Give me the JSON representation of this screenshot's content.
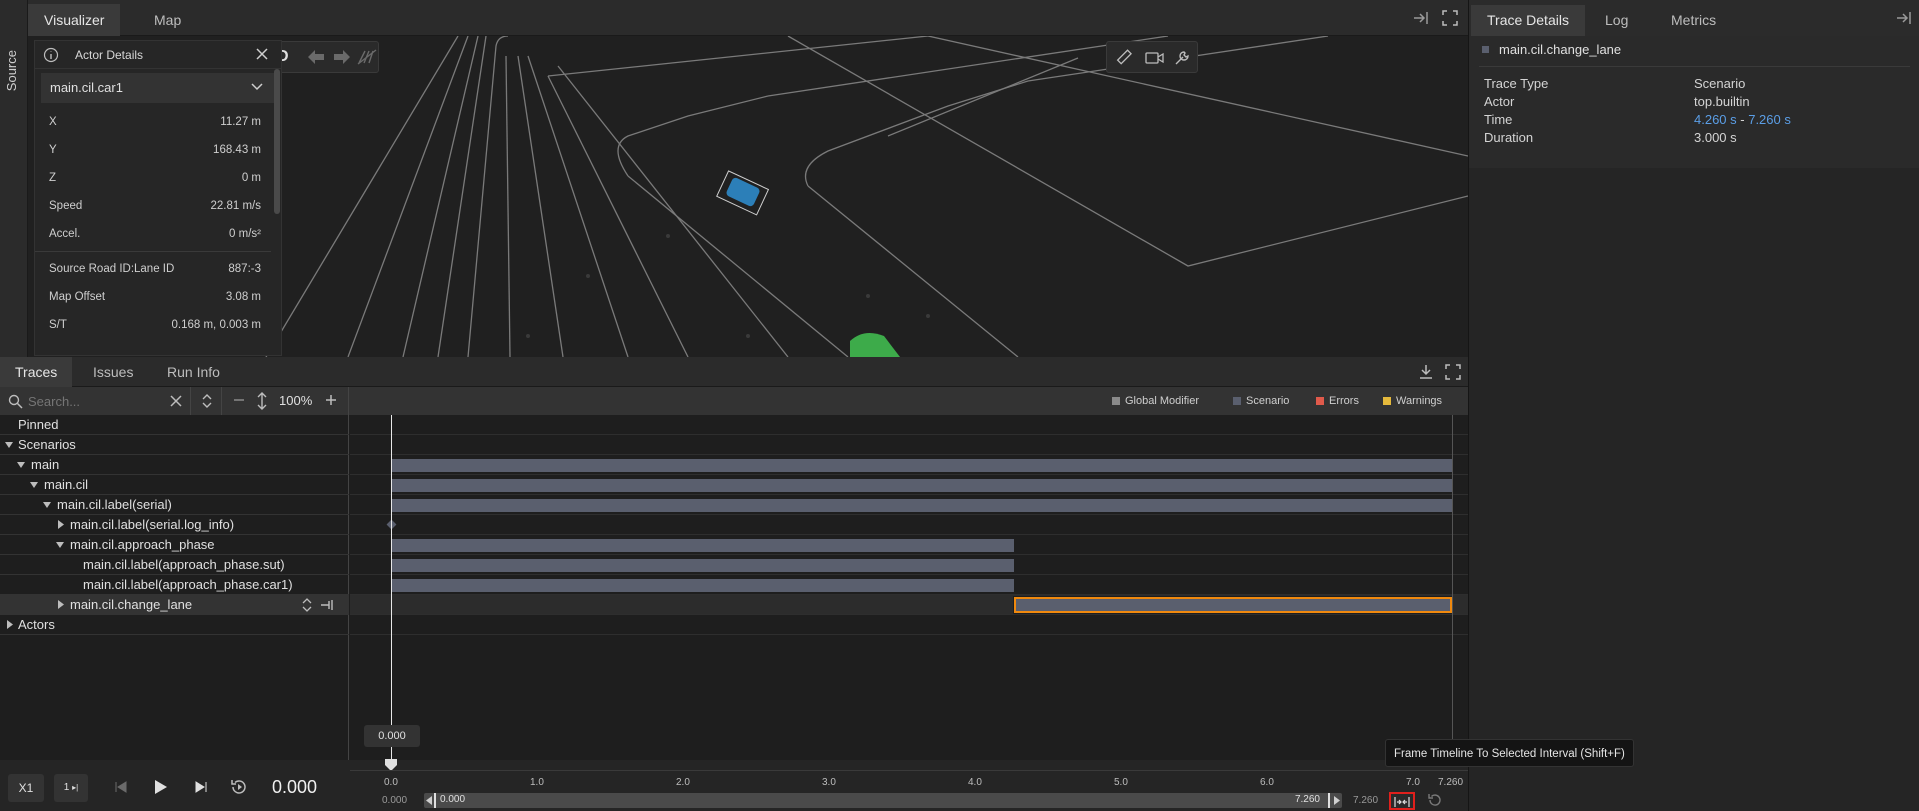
{
  "source_strip": {
    "label": "Source"
  },
  "top_tabs": [
    {
      "label": "Visualizer"
    },
    {
      "label": "Map"
    }
  ],
  "viewport_toolbar": {
    "drive_mode": "D"
  },
  "actor_details": {
    "title": "Actor Details",
    "selected_actor": "main.cil.car1",
    "rows": [
      {
        "label": "X",
        "value": "11.27 m"
      },
      {
        "label": "Y",
        "value": "168.43 m"
      },
      {
        "label": "Z",
        "value": "0 m"
      },
      {
        "label": "Speed",
        "value": "22.81 m/s"
      },
      {
        "label": "Accel.",
        "value": "0 m/s²"
      },
      {
        "label": "Source Road ID:Lane ID",
        "value": "887:-3"
      },
      {
        "label": "Map Offset",
        "value": "3.08 m"
      },
      {
        "label": "S/T",
        "value": "0.168 m, 0.003 m"
      }
    ]
  },
  "right_panel": {
    "tabs": [
      {
        "label": "Trace Details"
      },
      {
        "label": "Log"
      },
      {
        "label": "Metrics"
      }
    ],
    "trace_name": "main.cil.change_lane",
    "details": {
      "trace_type_label": "Trace Type",
      "trace_type": "Scenario",
      "actor_label": "Actor",
      "actor": "top.builtin",
      "time_label": "Time",
      "time_start": "4.260 s",
      "time_sep": " - ",
      "time_end": "7.260 s",
      "duration_label": "Duration",
      "duration": "3.000 s"
    }
  },
  "bottom_tabs": [
    {
      "label": "Traces"
    },
    {
      "label": "Issues"
    },
    {
      "label": "Run Info"
    }
  ],
  "search": {
    "placeholder": "Search...",
    "zoom": "100%"
  },
  "legend": [
    {
      "label": "Global Modifier",
      "color": "#8a8a8a"
    },
    {
      "label": "Scenario",
      "color": "#5a5f6e"
    },
    {
      "label": "Errors",
      "color": "#e05a4b"
    },
    {
      "label": "Warnings",
      "color": "#e5b93c"
    }
  ],
  "tree": [
    {
      "label": "Pinned"
    },
    {
      "label": "Scenarios"
    },
    {
      "label": "main"
    },
    {
      "label": "main.cil"
    },
    {
      "label": "main.cil.label(serial)"
    },
    {
      "label": "main.cil.label(serial.log_info)"
    },
    {
      "label": "main.cil.approach_phase"
    },
    {
      "label": "main.cil.label(approach_phase.sut)"
    },
    {
      "label": "main.cil.label(approach_phase.car1)"
    },
    {
      "label": "main.cil.change_lane"
    },
    {
      "label": "Actors"
    }
  ],
  "trace_intervals": [
    {
      "name": "main",
      "start": 0.0,
      "end": 7.26
    },
    {
      "name": "main.cil",
      "start": 0.0,
      "end": 7.26
    },
    {
      "name": "main.cil.label(serial)",
      "start": 0.0,
      "end": 7.26
    },
    {
      "name": "main.cil.approach_phase",
      "start": 0.0,
      "end": 4.26
    },
    {
      "name": "main.cil.label(approach_phase.sut)",
      "start": 0.0,
      "end": 4.26
    },
    {
      "name": "main.cil.label(approach_phase.car1)",
      "start": 0.0,
      "end": 4.26
    },
    {
      "name": "main.cil.change_lane",
      "start": 4.26,
      "end": 7.26,
      "selected": true
    }
  ],
  "timeline": {
    "cursor_time": "0.000",
    "ticks": [
      "0.0",
      "1.0",
      "2.0",
      "3.0",
      "4.0",
      "5.0",
      "6.0",
      "7.0",
      "7.260"
    ],
    "range_start": "0.000",
    "range_left": "0.000",
    "range_right": "7.260",
    "range_end": "7.260",
    "tooltip": "Frame Timeline To Selected Interval (Shift+F)"
  },
  "player": {
    "speed": "X1",
    "step": "1",
    "time": "0.000"
  }
}
